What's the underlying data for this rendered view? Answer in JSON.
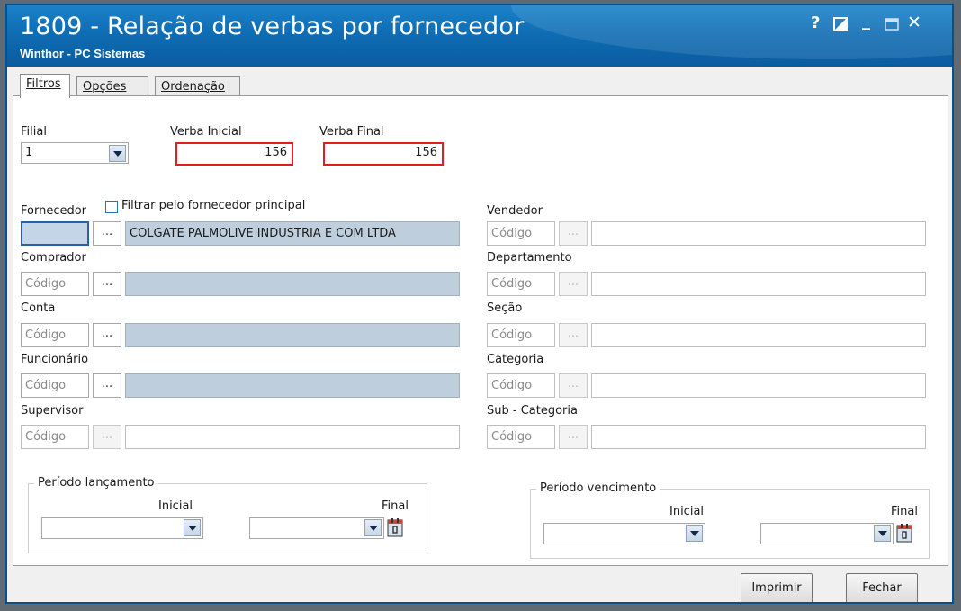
{
  "window": {
    "title": "1809 - Relação de verbas por fornecedor",
    "subtitle": "Winthor - PC Sistemas",
    "help_label": "?",
    "minimize_label": "_",
    "close_label": "✕"
  },
  "tabs": [
    {
      "label": "Filtros",
      "active": true
    },
    {
      "label": "Opções",
      "active": false
    },
    {
      "label": "Ordenação",
      "active": false
    }
  ],
  "filial": {
    "label": "Filial",
    "value": "1"
  },
  "verba_inicial": {
    "label": "Verba Inicial",
    "value": "156"
  },
  "verba_final": {
    "label": "Verba Final",
    "value": "156"
  },
  "placeholder": "Código",
  "dots_label": "...",
  "fornecedor": {
    "label": "Fornecedor",
    "checkbox_label": "Filtrar pelo fornecedor principal",
    "code": "",
    "name": "COLGATE PALMOLIVE INDUSTRIA  E COM LTDA"
  },
  "left_fields": [
    {
      "label": "Comprador"
    },
    {
      "label": "Conta"
    },
    {
      "label": "Funcionário"
    },
    {
      "label": "Supervisor"
    }
  ],
  "right_fields": [
    {
      "label": "Vendedor"
    },
    {
      "label": "Departamento"
    },
    {
      "label": "Seção"
    },
    {
      "label": "Categoria"
    },
    {
      "label": "Sub - Categoria"
    }
  ],
  "periodo_lancamento": {
    "title": "Período lançamento",
    "inicial": "Inicial",
    "final": "Final"
  },
  "periodo_vencimento": {
    "title": "Período vencimento",
    "inicial": "Inicial",
    "final": "Final"
  },
  "buttons": {
    "imprimir": "Imprimir",
    "fechar": "Fechar"
  },
  "colors": {
    "titlebar": "#0f6db4",
    "highlight": "#e02020",
    "readonly_field": "#bfcedc"
  }
}
